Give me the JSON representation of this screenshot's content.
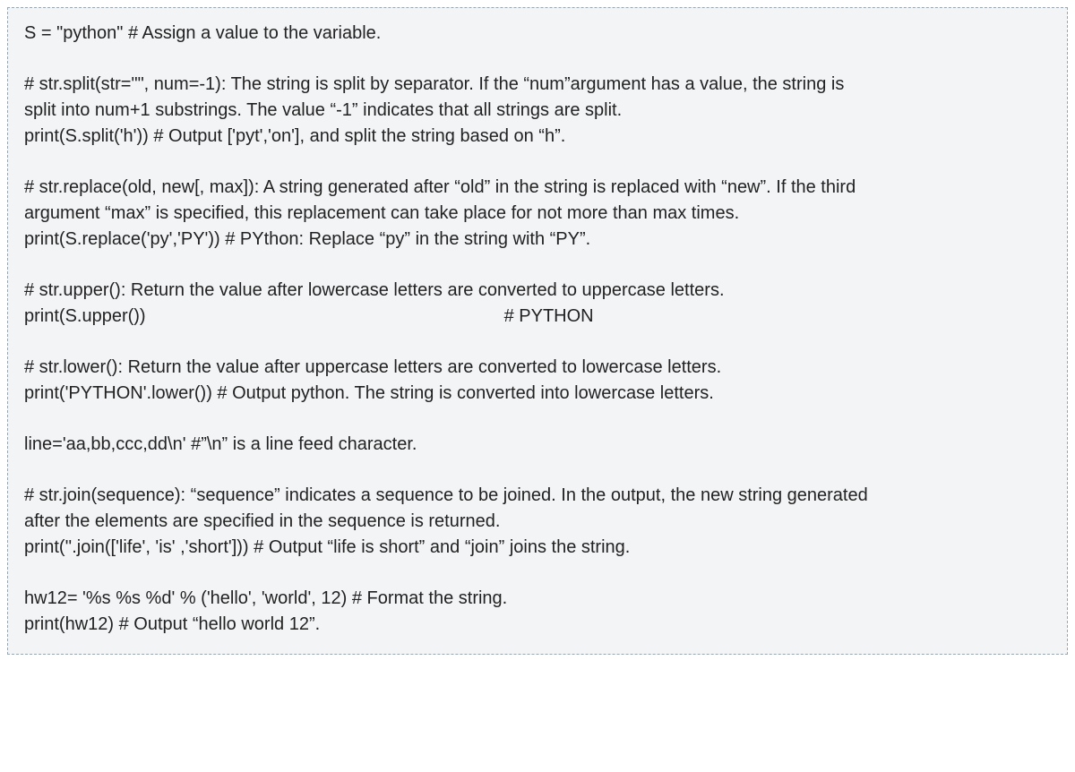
{
  "code": {
    "l1": "S = \"python\" # Assign a value to the variable.",
    "l2a": "#    str.split(str=\"\", num=-1): The string is split by separator. If the “num”argument has a value, the string is",
    "l2b": "split into num+1 substrings. The value “-1” indicates that all strings are split.",
    "l2c": "print(S.split('h')) # Output ['pyt','on'], and split the string based on “h”.",
    "l3a": "#    str.replace(old, new[, max]): A string generated after “old” in the string is replaced with “new”. If the third",
    "l3b": "argument “max” is specified, this replacement can take place for not more than max times.",
    "l3c": "print(S.replace('py','PY')) # PYthon: Replace “py” in the string with “PY”.",
    "l4a": "#    str.upper(): Return the value after lowercase letters are converted to uppercase letters.",
    "l4b_left": "print(S.upper())",
    "l4b_right": "# PYTHON",
    "l5a": "#    str.lower(): Return the value after uppercase letters are converted to lowercase letters.",
    "l5b": "print('PYTHON'.lower()) # Output python. The string is converted into lowercase letters.",
    "l6": "line='aa,bb,ccc,dd\\n' #”\\n” is a line feed character.",
    "l7a": "#    str.join(sequence): “sequence” indicates a sequence to be joined. In the output, the new string generated",
    "l7b": "after the elements are specified in the sequence is returned.",
    "l7c": "print(''.join(['life', 'is' ,'short'])) # Output “life is short” and “join” joins the string.",
    "l8a": "hw12= '%s %s %d' % ('hello', 'world', 12) # Format the string.",
    "l8b": "print(hw12) # Output “hello world 12”."
  }
}
